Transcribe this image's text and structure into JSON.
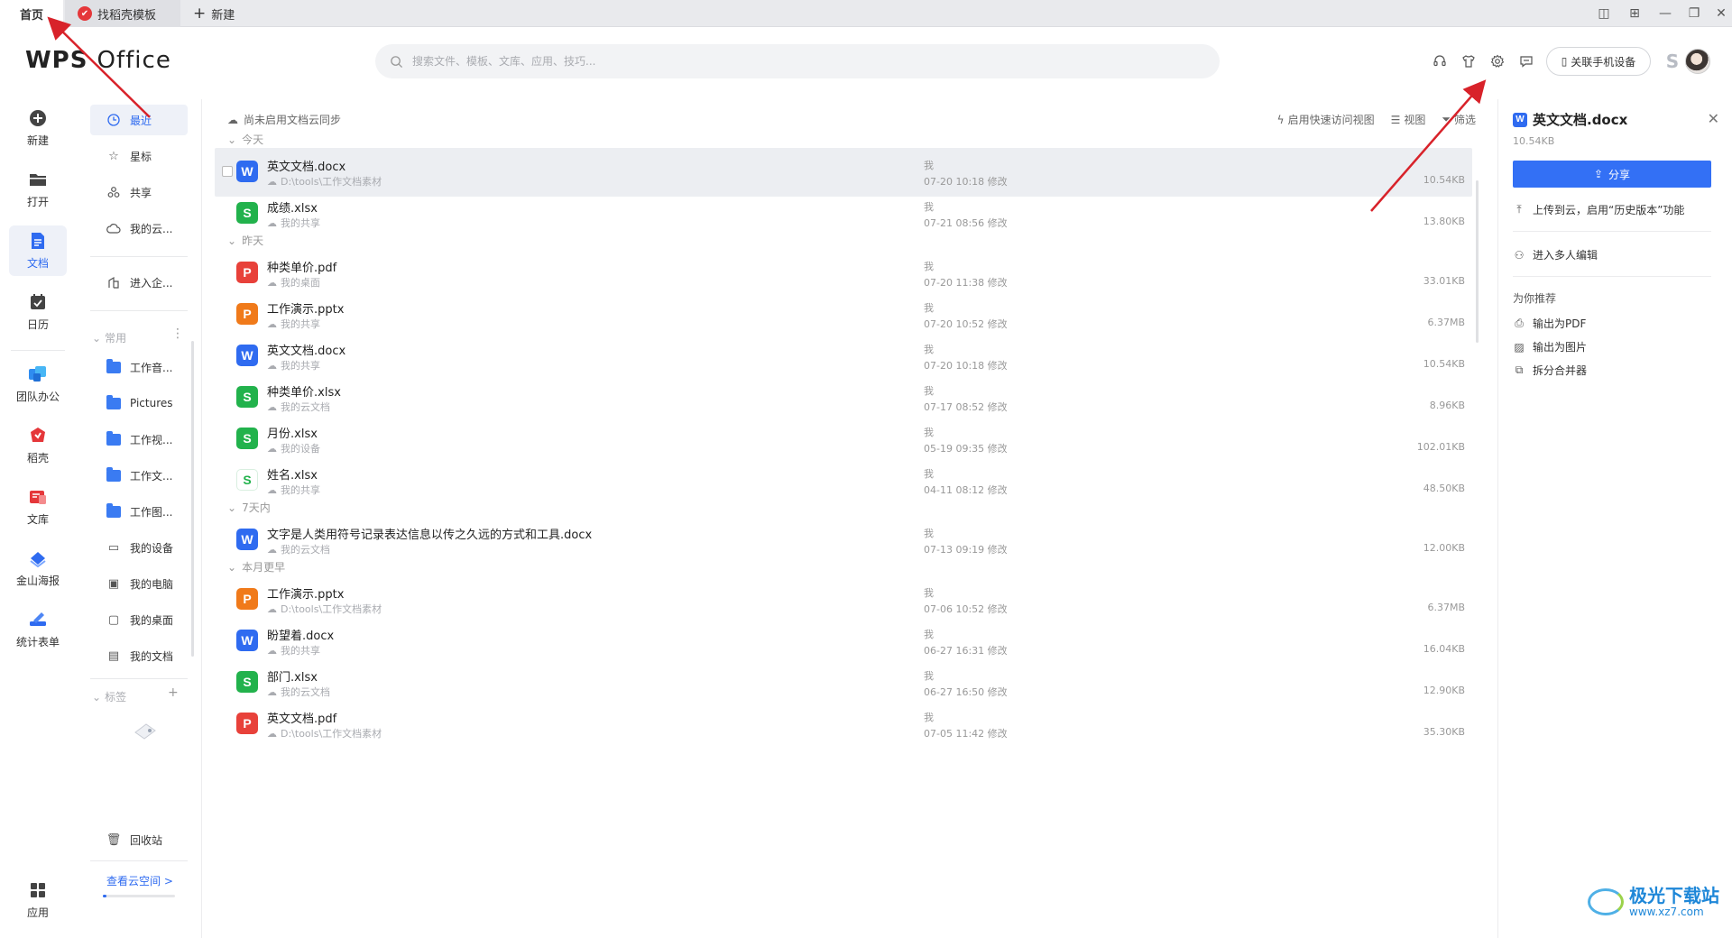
{
  "tabs": {
    "home": "首页",
    "daoke": "找稻壳模板",
    "new": "新建"
  },
  "header": {
    "logo_text_a": "WPS",
    "logo_text_b": "Office",
    "search_placeholder": "搜索文件、模板、文库、应用、技巧...",
    "phone_button": "关联手机设备"
  },
  "leftnav": [
    {
      "label": "新建",
      "icon": "plus-circle-icon"
    },
    {
      "label": "打开",
      "icon": "folder-open-icon"
    },
    {
      "label": "文档",
      "icon": "document-icon"
    },
    {
      "label": "日历",
      "icon": "calendar-icon"
    },
    {
      "label": "团队办公",
      "icon": "team-icon"
    },
    {
      "label": "稻壳",
      "icon": "daoke-icon"
    },
    {
      "label": "文库",
      "icon": "library-icon"
    },
    {
      "label": "金山海报",
      "icon": "poster-icon"
    },
    {
      "label": "统计表单",
      "icon": "form-icon"
    },
    {
      "label": "应用",
      "icon": "apps-grid-icon"
    }
  ],
  "col2": {
    "top_items": [
      {
        "label": "最近",
        "icon": "clock-icon"
      },
      {
        "label": "星标",
        "icon": "star-icon"
      },
      {
        "label": "共享",
        "icon": "share-people-icon"
      },
      {
        "label": "我的云...",
        "icon": "cloud-icon"
      }
    ],
    "enterprise": "进入企...",
    "common_label": "常用",
    "common_items": [
      {
        "label": "工作音...",
        "icon": "folder-icon"
      },
      {
        "label": "Pictures",
        "icon": "folder-icon"
      },
      {
        "label": "工作视...",
        "icon": "folder-icon"
      },
      {
        "label": "工作文...",
        "icon": "folder-icon"
      },
      {
        "label": "工作图...",
        "icon": "folder-icon"
      },
      {
        "label": "我的设备",
        "icon": "device-icon"
      },
      {
        "label": "我的电脑",
        "icon": "computer-icon"
      },
      {
        "label": "我的桌面",
        "icon": "desktop-icon"
      },
      {
        "label": "我的文档",
        "icon": "my-docs-icon"
      }
    ],
    "tags_label": "标签",
    "recycle": "回收站",
    "cloud_link": "查看云空间 >",
    "cloud_usage_fraction": 0.05
  },
  "main": {
    "sync_notice": "尚未启用文档云同步",
    "quick_view": "启用快速访问视图",
    "view": "视图",
    "filter": "筛选",
    "groups": [
      {
        "label": "今天",
        "rows": [
          {
            "type": "w",
            "name": "英文文档.docx",
            "path": "D:\\tools\\工作文档素材",
            "owner": "我",
            "time": "07-20 10:18 修改",
            "size": "10.54KB",
            "selected": true
          },
          {
            "type": "s",
            "name": "成绩.xlsx",
            "path": "我的共享",
            "owner": "我",
            "time": "07-21 08:56 修改",
            "size": "13.80KB"
          }
        ]
      },
      {
        "label": "昨天",
        "rows": [
          {
            "type": "pdf",
            "name": "种类单价.pdf",
            "path": "我的桌面",
            "owner": "我",
            "time": "07-20 11:38 修改",
            "size": "33.01KB"
          },
          {
            "type": "p",
            "name": "工作演示.pptx",
            "path": "我的共享",
            "owner": "我",
            "time": "07-20 10:52 修改",
            "size": "6.37MB"
          },
          {
            "type": "w",
            "name": "英文文档.docx",
            "path": "我的共享",
            "owner": "我",
            "time": "07-20 10:18 修改",
            "size": "10.54KB"
          },
          {
            "type": "s",
            "name": "种类单价.xlsx",
            "path": "我的云文档",
            "owner": "我",
            "time": "07-17 08:52 修改",
            "size": "8.96KB"
          },
          {
            "type": "s",
            "name": "月份.xlsx",
            "path": "我的设备",
            "owner": "我",
            "time": "05-19 09:35 修改",
            "size": "102.01KB"
          },
          {
            "type": "s-light",
            "name": "姓名.xlsx",
            "path": "我的共享",
            "owner": "我",
            "time": "04-11 08:12 修改",
            "size": "48.50KB"
          }
        ]
      },
      {
        "label": "7天内",
        "rows": [
          {
            "type": "w",
            "name": "文字是人类用符号记录表达信息以传之久远的方式和工具.docx",
            "path": "我的云文档",
            "owner": "我",
            "time": "07-13 09:19 修改",
            "size": "12.00KB"
          }
        ]
      },
      {
        "label": "本月更早",
        "rows": [
          {
            "type": "p",
            "name": "工作演示.pptx",
            "path": "D:\\tools\\工作文档素材",
            "owner": "我",
            "time": "07-06 10:52 修改",
            "size": "6.37MB"
          },
          {
            "type": "w",
            "name": "盼望着.docx",
            "path": "我的共享",
            "owner": "我",
            "time": "06-27 16:31 修改",
            "size": "16.04KB"
          },
          {
            "type": "s",
            "name": "部门.xlsx",
            "path": "我的云文档",
            "owner": "我",
            "time": "06-27 16:50 修改",
            "size": "12.90KB"
          },
          {
            "type": "pdf",
            "name": "英文文档.pdf",
            "path": "D:\\tools\\工作文档素材",
            "owner": "我",
            "time": "07-05 11:42 修改",
            "size": "35.30KB"
          }
        ]
      }
    ]
  },
  "rpanel": {
    "title": "英文文档.docx",
    "size": "10.54KB",
    "share": "分享",
    "upload": "上传到云，启用“历史版本”功能",
    "multi_edit": "进入多人编辑",
    "recommend": "为你推荐",
    "actions": [
      "输出为PDF",
      "输出为图片",
      "拆分合并器"
    ]
  },
  "watermark": {
    "title": "极光下载站",
    "url": "www.xz7.com"
  },
  "colors": {
    "accent": "#2f6bf0",
    "annotation_arrow": "#d8222a"
  }
}
